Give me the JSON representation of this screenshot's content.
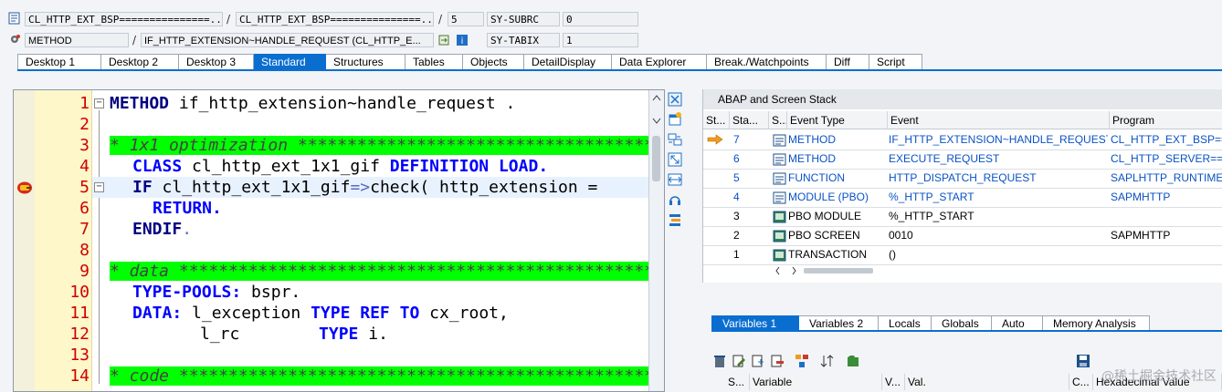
{
  "header": {
    "row1": {
      "program": "CL_HTTP_EXT_BSP===============...",
      "include": "CL_HTTP_EXT_BSP===============...",
      "line": "5",
      "sysfield_name": "SY-SUBRC",
      "sysfield_value": "0"
    },
    "row2": {
      "event_type": "METHOD",
      "event": "IF_HTTP_EXTENSION~HANDLE_REQUEST (CL_HTTP_E...",
      "sysfield_name": "SY-TABIX",
      "sysfield_value": "1"
    },
    "sep": "/"
  },
  "tabs": [
    "Desktop 1",
    "Desktop 2",
    "Desktop 3",
    "Standard",
    "Structures",
    "Tables",
    "Objects",
    "DetailDisplay",
    "Data Explorer",
    "Break./Watchpoints",
    "Diff",
    "Script"
  ],
  "active_tab": "Standard",
  "editor": {
    "line_numbers": [
      "1",
      "2",
      "3",
      "4",
      "5",
      "6",
      "7",
      "8",
      "9",
      "10",
      "11",
      "12",
      "13",
      "14"
    ],
    "lines": {
      "l1_kw": "METHOD",
      "l1_rest": " if_http_extension~handle_request .",
      "l3": "* 1x1 optimization ************************************************",
      "l4_kw1": "CLASS",
      "l4_name": " cl_http_ext_1x1_gif ",
      "l4_kw2": "DEFINITION LOAD.",
      "l5_kw": "IF",
      "l5_a": " cl_http_ext_1x1_gif",
      "l5_op": "=>",
      "l5_b": "check",
      "l5_c": "( http_extension =",
      "l6_kw": "RETURN.",
      "l7_kw": "ENDIF",
      "l7_dot": ".",
      "l9": "* data *************************************************************",
      "l10_kw": "TYPE-POOLS:",
      "l10_rest": " bspr.",
      "l11_kw": "DATA:",
      "l11_a": " l_exception ",
      "l11_kw2": "TYPE REF TO",
      "l11_b": " cx_root,",
      "l12_a": "l_rc        ",
      "l12_kw": "TYPE",
      "l12_b": " i.",
      "l14": "* code *************************************************************"
    }
  },
  "stack": {
    "title": "ABAP and Screen Stack",
    "columns": [
      "St...",
      "Sta...",
      "S...",
      "Event Type",
      "Event",
      "Program"
    ],
    "rows": [
      {
        "level": "7",
        "type": "METHOD",
        "event": "IF_HTTP_EXTENSION~HANDLE_REQUEST",
        "program": "CL_HTTP_EXT_BSP==",
        "current": true,
        "abap": true
      },
      {
        "level": "6",
        "type": "METHOD",
        "event": "EXECUTE_REQUEST",
        "program": "CL_HTTP_SERVER===",
        "current": false,
        "abap": true
      },
      {
        "level": "5",
        "type": "FUNCTION",
        "event": "HTTP_DISPATCH_REQUEST",
        "program": "SAPLHTTP_RUNTIME",
        "current": false,
        "abap": true
      },
      {
        "level": "4",
        "type": "MODULE (PBO)",
        "event": "%_HTTP_START",
        "program": "SAPMHTTP",
        "current": false,
        "abap": true
      },
      {
        "level": "3",
        "type": "PBO MODULE",
        "event": "%_HTTP_START",
        "program": "",
        "current": false,
        "abap": false
      },
      {
        "level": "2",
        "type": "PBO SCREEN",
        "event": "0010",
        "program": "SAPMHTTP",
        "current": false,
        "abap": false
      },
      {
        "level": "1",
        "type": "TRANSACTION",
        "event": "()",
        "program": "",
        "current": false,
        "abap": false
      }
    ]
  },
  "var_tabs": [
    "Variables 1",
    "Variables 2",
    "Locals",
    "Globals",
    "Auto",
    "Memory Analysis"
  ],
  "active_var_tab": "Variables 1",
  "var_columns": [
    "S...",
    "Variable",
    "V...",
    "Val.",
    "C...",
    "Hexadecimal Value"
  ],
  "watermark": "@稀土掘金技术社区",
  "colors": {
    "accent": "#0a6ed1",
    "comment_bg": "#00ff00",
    "keyword": "#0000ff",
    "line_number": "#d00000"
  }
}
